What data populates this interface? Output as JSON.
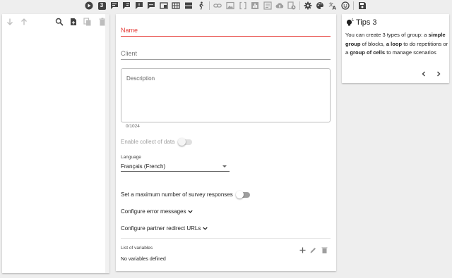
{
  "toolbar": {
    "items": [
      {
        "name": "play-icon"
      },
      {
        "name": "number-block-icon",
        "label": "3"
      },
      {
        "name": "chat-icon"
      },
      {
        "name": "chat-reply-icon"
      },
      {
        "name": "chat-alert-icon"
      },
      {
        "name": "chat-dots-icon"
      },
      {
        "name": "window-icon"
      },
      {
        "name": "table-icon"
      },
      {
        "name": "split-layout-icon"
      },
      {
        "name": "person-walk-icon"
      },
      {
        "name": "link-icon"
      },
      {
        "name": "image-icon"
      },
      {
        "name": "brackets-icon"
      },
      {
        "name": "bar-chart-icon"
      },
      {
        "name": "list-box-icon"
      },
      {
        "name": "cloud-upload-icon"
      },
      {
        "name": "history-icon"
      },
      {
        "name": "gear-icon"
      },
      {
        "name": "palette-icon"
      },
      {
        "name": "translate-icon"
      },
      {
        "name": "face-icon"
      },
      {
        "name": "save-icon"
      }
    ]
  },
  "form": {
    "name_label": "Name",
    "client_label": "Client",
    "description_label": "Description",
    "description_counter": "0/1024",
    "collect_label": "Enable collect of data",
    "language_label": "Language",
    "language_value": "Français (French)",
    "max_responses_label": "Set a maximum number of survey responses",
    "error_messages_label": "Configure error messages",
    "redirect_urls_label": "Configure partner redirect URLs",
    "variables_title": "List of variables",
    "variables_empty": "No variables defined"
  },
  "tips": {
    "title": "Tips 3",
    "parts": [
      "You can create 3 types of group: a ",
      "simple group",
      " of blocks, ",
      "a loop",
      " to do repetitions or a ",
      "group of cells",
      " to manage scenarios"
    ]
  },
  "colors": {
    "accent_red": "#e53935",
    "toolbar_icon": "#424242",
    "background": "#eeeeee"
  }
}
